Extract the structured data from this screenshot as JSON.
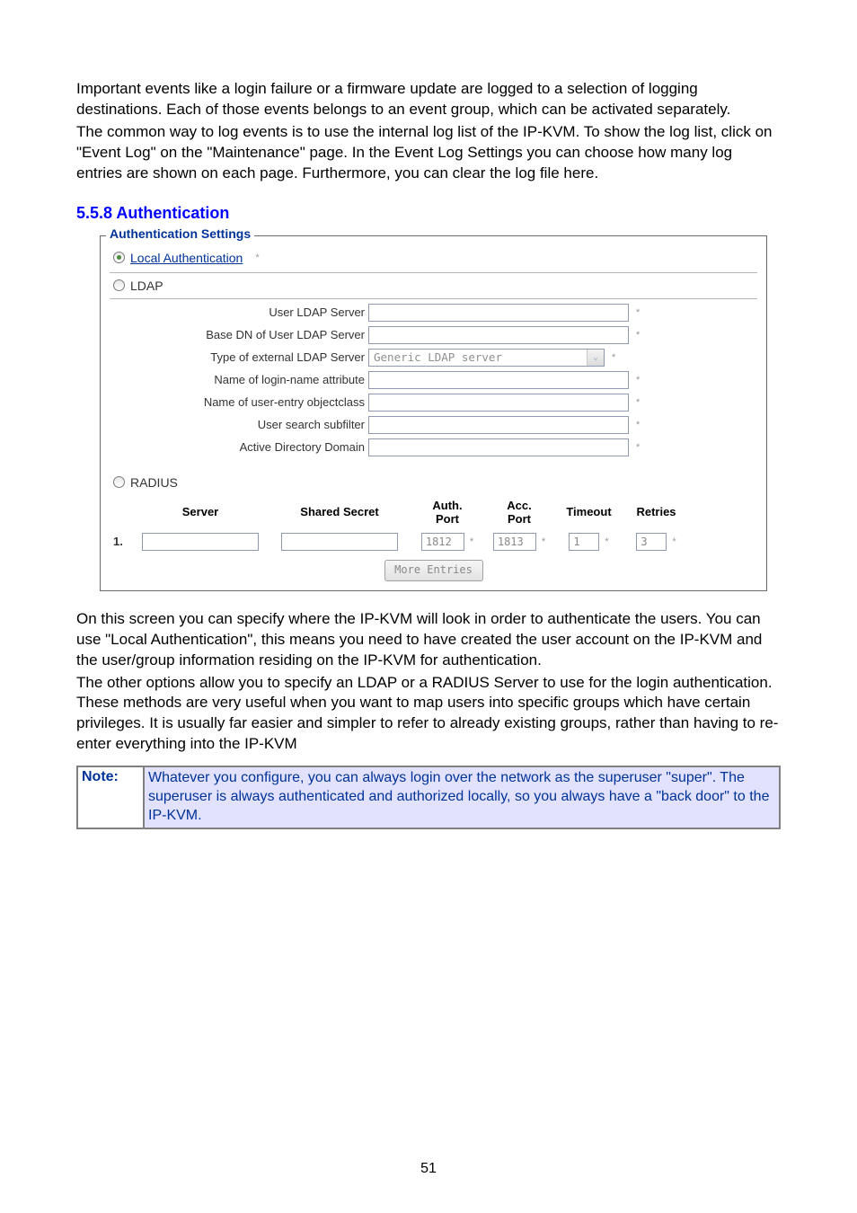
{
  "intro": {
    "p1": "Important events like a login failure or a firmware update are logged to a selection of logging destinations. Each of those events belongs to an event group, which can be activated separately.",
    "p2": "The common way to log events is to use the internal log list of the IP-KVM. To show the log list, click on \"Event Log\" on the \"Maintenance\" page. In the Event Log Settings you can choose how many log entries are shown on each page. Furthermore, you can clear the log file here."
  },
  "section_heading": "5.5.8 Authentication",
  "fieldset": {
    "legend": "Authentication Settings",
    "local_auth_label": "Local Authentication",
    "ldap_label": "LDAP",
    "ldap_fields": {
      "user_ldap_server": "User LDAP Server",
      "base_dn": "Base DN of User LDAP Server",
      "type_ext": "Type of external LDAP Server",
      "type_ext_value": "Generic LDAP server",
      "login_name_attr": "Name of login-name attribute",
      "user_entry_class": "Name of user-entry objectclass",
      "search_subfilter": "User search subfilter",
      "ad_domain": "Active Directory Domain"
    },
    "radius_label": "RADIUS",
    "radius_headers": {
      "server": "Server",
      "secret": "Shared Secret",
      "auth_port": "Auth.\nPort",
      "acc_port": "Acc.\nPort",
      "timeout": "Timeout",
      "retries": "Retries"
    },
    "radius_row": {
      "num": "1.",
      "auth_port": "1812",
      "acc_port": "1813",
      "timeout": "1",
      "retries": "3"
    },
    "more_entries_btn": "More Entries"
  },
  "outro": {
    "p1": "On this screen you can specify where the IP-KVM will look in order to authenticate the users. You can use \"Local Authentication\", this means you need to have created the user account on the IP-KVM and the user/group information residing on the IP-KVM for authentication.",
    "p2": "The other options allow you to specify an LDAP or a RADIUS Server to use for the login authentication. These methods are very useful when you want to map users into specific groups which have certain privileges. It is usually far easier and simpler to refer to already existing groups, rather than having to re-enter everything into the IP-KVM"
  },
  "note": {
    "label": "Note:",
    "text": "Whatever you configure, you can always login over the network as the superuser \"super\". The superuser is always authenticated and authorized locally, so you always have a \"back door\" to the IP-KVM."
  },
  "page_number": "51"
}
